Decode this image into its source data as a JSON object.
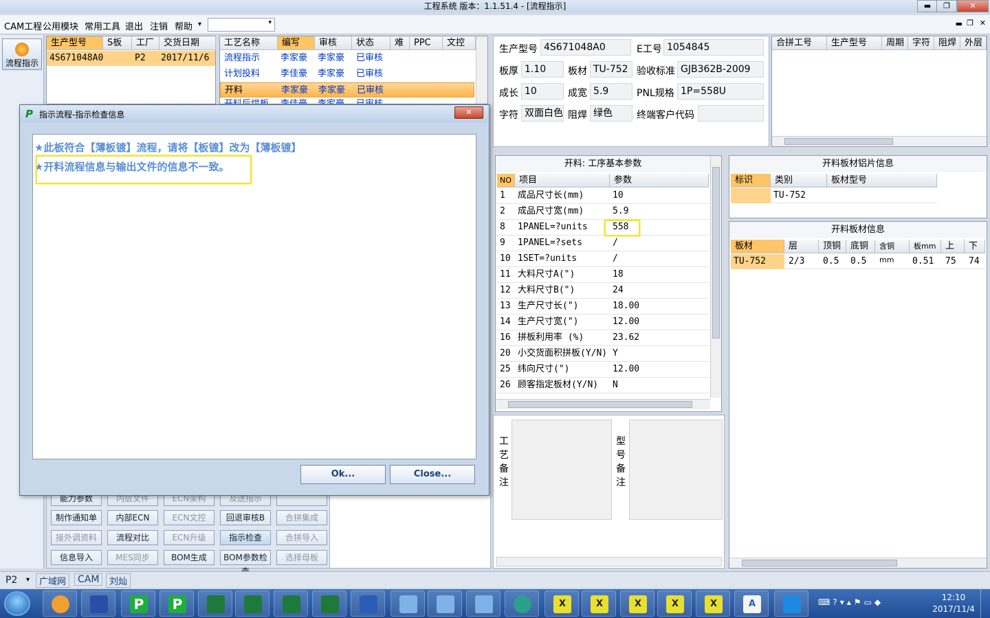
{
  "window": {
    "title": "工程系统    版本：1.1.51.4 - [流程指示]",
    "min": "▬",
    "max": "❐",
    "close": "✕"
  },
  "menu": {
    "items": [
      "CAM工程",
      "公用模块",
      "常用工具",
      "退出",
      "注销",
      "帮助"
    ],
    "help_arrow": "▾"
  },
  "sidebar": {
    "flow_button": "流程指示"
  },
  "model_grid": {
    "headers": [
      "生产型号",
      "S板",
      "工厂",
      "交货日期"
    ],
    "row": {
      "model": "4S671048A0",
      "factory": "P2",
      "date": "2017/11/6"
    }
  },
  "process_grid": {
    "headers": [
      "工艺名称",
      "编写",
      "审核",
      "状态",
      "难",
      "PPC",
      "文控"
    ],
    "rows": [
      {
        "name": "流程指示",
        "writer": "李家豪",
        "reviewer": "李家豪",
        "status": "已审核"
      },
      {
        "name": "计划投料",
        "writer": "李佳豪",
        "reviewer": "李家豪",
        "status": "已审核"
      },
      {
        "name": "开料",
        "writer": "李家豪",
        "reviewer": "李家豪",
        "status": "已审核"
      },
      {
        "name": "开料后烘板",
        "writer": "李佳豪",
        "reviewer": "李家豪",
        "status": "已审核"
      }
    ]
  },
  "info": {
    "model_label": "生产型号",
    "model": "4S671048A0",
    "eno_label": "E工号",
    "eno": "1054845",
    "thickness_label": "板厚",
    "thickness": "1.10",
    "material_label": "板材",
    "material": "TU-752",
    "standard_label": "验收标准",
    "standard": "GJB362B-2009",
    "len_label": "成长",
    "len": "10",
    "width_label": "成宽",
    "width": "5.9",
    "pnl_label": "PNL规格",
    "pnl": "1P=558U",
    "char_label": "字符",
    "char": "双面白色",
    "mask_label": "阻焊",
    "mask": "绿色",
    "customer_label": "终端客户代码",
    "customer": ""
  },
  "merge_grid": {
    "headers": [
      "合拼工号",
      "生产型号",
      "周期",
      "字符",
      "阻焊",
      "外层"
    ]
  },
  "params": {
    "title": "开料: 工序基本参数",
    "headers": [
      "NO",
      "项目",
      "参数"
    ],
    "rows": [
      [
        "1",
        "成品尺寸长(mm)",
        "10"
      ],
      [
        "2",
        "成品尺寸宽(mm)",
        "5.9"
      ],
      [
        "8",
        "1PANEL=?units",
        "558"
      ],
      [
        "9",
        "1PANEL=?sets",
        "/"
      ],
      [
        "10",
        "1SET=?units",
        "/"
      ],
      [
        "11",
        "大料尺寸A(\")",
        "18"
      ],
      [
        "12",
        "大料尺寸B(\")",
        "24"
      ],
      [
        "13",
        "生产尺寸长(\")",
        "18.00"
      ],
      [
        "14",
        "生产尺寸宽(\")",
        "12.00"
      ],
      [
        "16",
        "拼板利用率 (%)",
        "23.62"
      ],
      [
        "20",
        "小交货面积拼板(Y/N)",
        "Y"
      ],
      [
        "25",
        "纬向尺寸(\")",
        "12.00"
      ],
      [
        "26",
        "顾客指定板材(Y/N)",
        "N"
      ]
    ]
  },
  "aluminum": {
    "title": "开料板材铝片信息",
    "headers": [
      "标识",
      "类别",
      "板材型号"
    ],
    "row": [
      "",
      "TU-752",
      ""
    ]
  },
  "board": {
    "title": "开料板材信息",
    "headers": [
      "板材",
      "层",
      "顶铜",
      "底铜",
      "含铜mm",
      "板mm",
      "上",
      "下"
    ],
    "row": [
      "TU-752",
      "2/3",
      "0.5",
      "0.5",
      "",
      "0.51",
      "75",
      "74"
    ]
  },
  "remarks": {
    "process_label": "工艺备注",
    "model_label": "型号备注"
  },
  "buttons": {
    "row0": [
      "能力参数",
      "内层文件",
      "ECN架构",
      "及送指示",
      ""
    ],
    "row1": [
      "制作通知单",
      "内部ECN",
      "ECN文控",
      "回退审核B",
      "合拼集成"
    ],
    "row2": [
      "接外调资料",
      "流程对比",
      "ECN升级",
      "指示检查",
      "合拼导入"
    ],
    "row3": [
      "信息导入",
      "MES同步",
      "BOM生成",
      "BOM参数检查",
      "选择母板"
    ]
  },
  "dialog": {
    "title": "指示流程-指示检查信息",
    "line1": "★此板符合【薄板镀】流程，请将【板镀】改为【薄板镀】",
    "line2": "★开料流程信息与输出文件的信息不一致。",
    "ok": "Ok...",
    "close": "Close..."
  },
  "statusbar": {
    "factory": "P2",
    "net": "广域网",
    "module": "CAM",
    "user": "刘灿"
  },
  "taskbar": {
    "time": "12:10",
    "date": "2017/11/4"
  }
}
